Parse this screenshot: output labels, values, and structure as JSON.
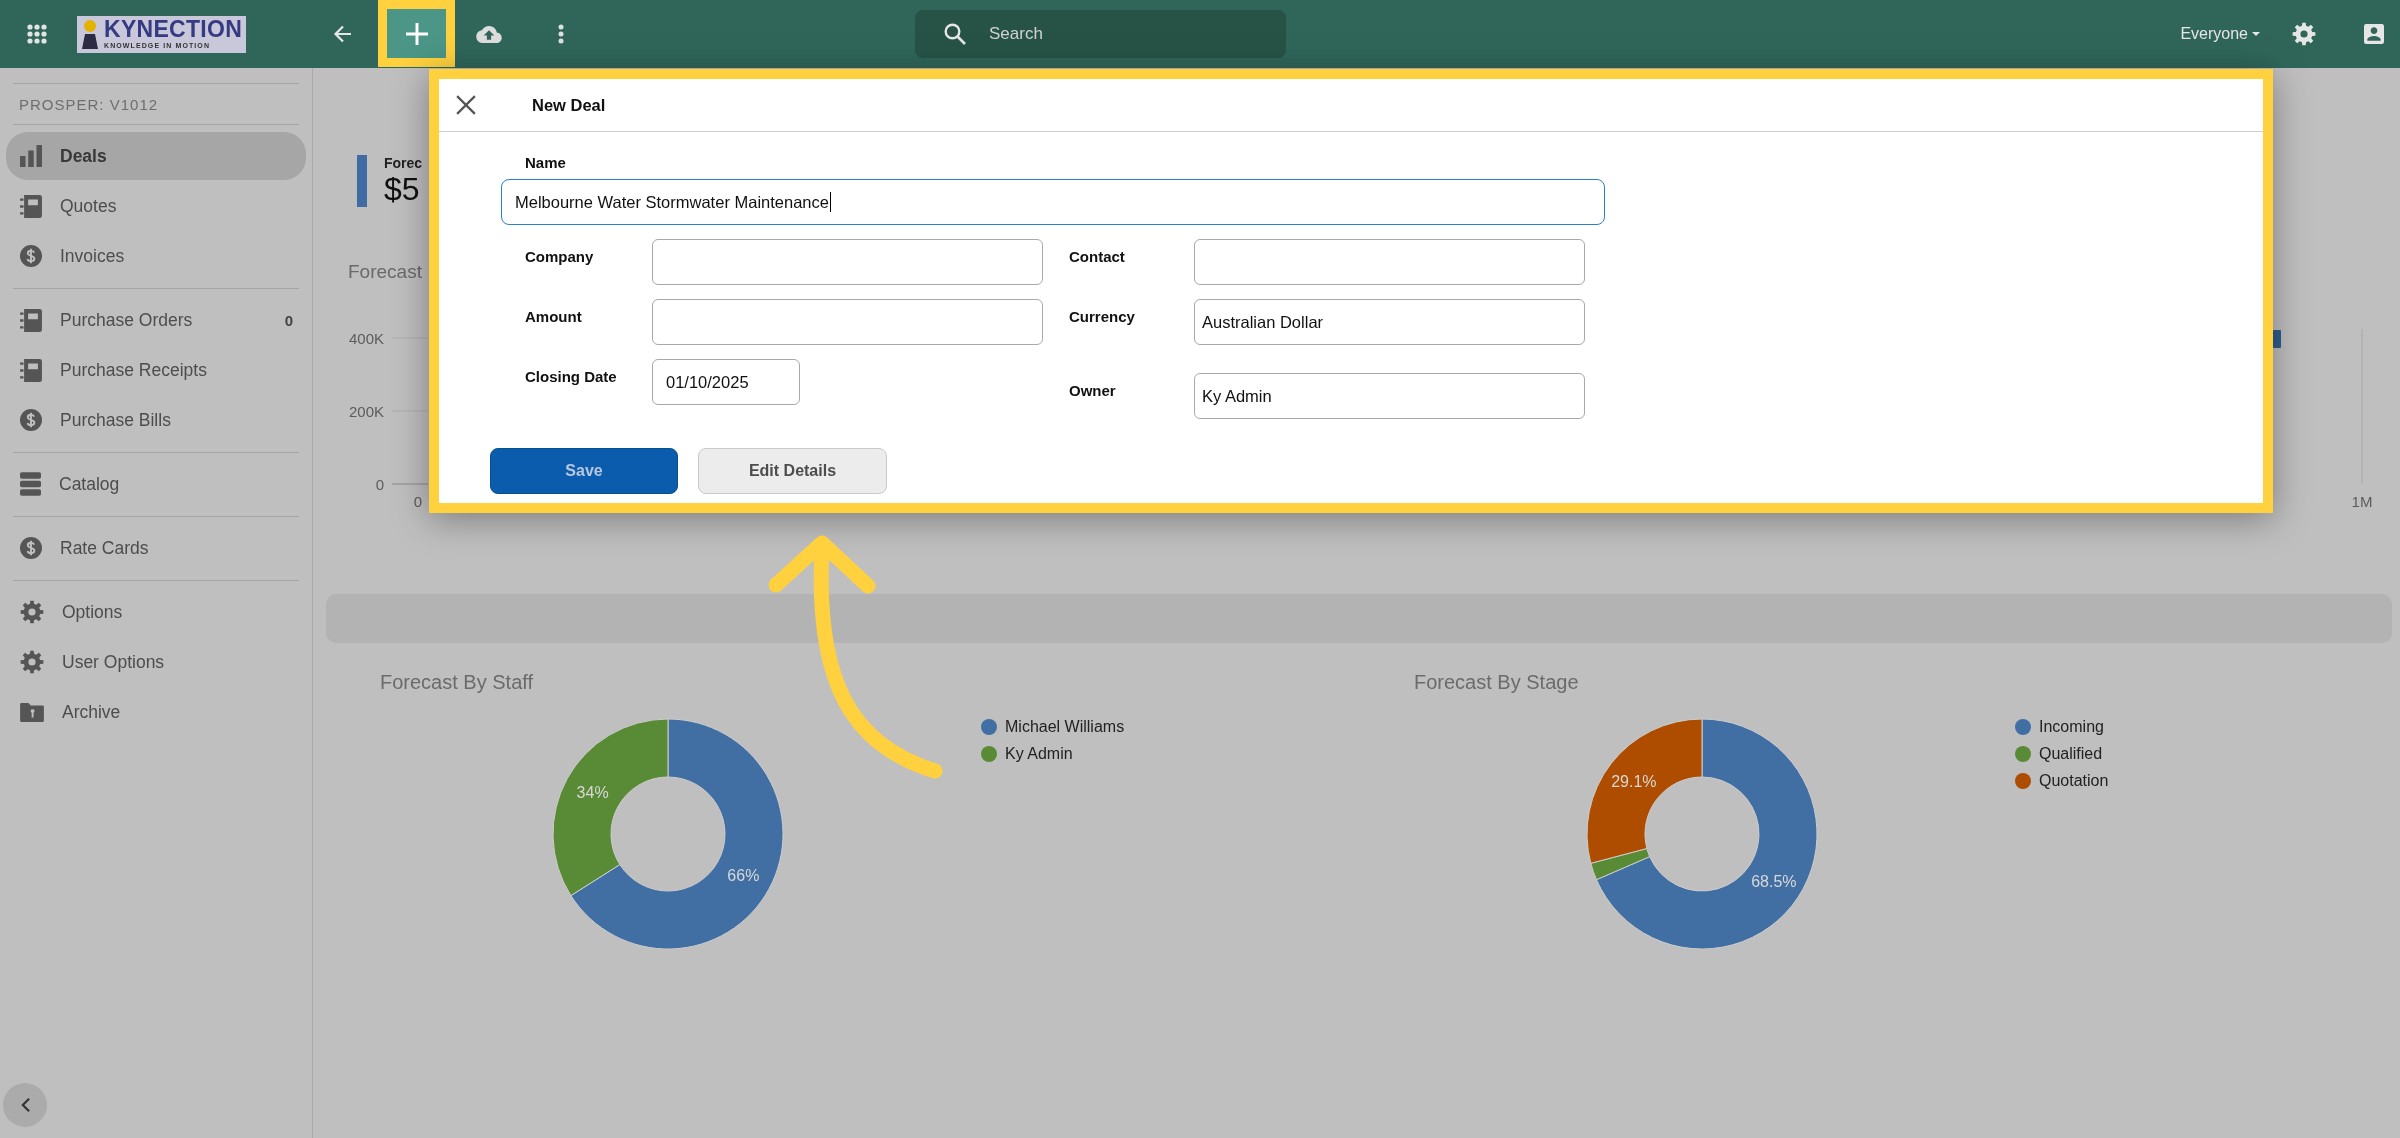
{
  "topbar": {
    "logo": {
      "name": "KYNECTION",
      "tagline": "KNOWLEDGE IN MOTION"
    },
    "search": {
      "placeholder": "Search"
    },
    "scope": "Everyone"
  },
  "sidebar": {
    "header": "PROSPER: V1012",
    "sections": [
      {
        "items": [
          {
            "label": "Deals",
            "kind": "report",
            "selected": true
          },
          {
            "label": "Quotes",
            "kind": "document",
            "selected": false
          },
          {
            "label": "Invoices",
            "kind": "payment",
            "selected": false
          }
        ]
      },
      {
        "items": [
          {
            "label": "Purchase Orders",
            "kind": "document",
            "selected": false,
            "count": "0"
          },
          {
            "label": "Purchase Receipts",
            "kind": "document",
            "selected": false
          },
          {
            "label": "Purchase Bills",
            "kind": "payment",
            "selected": false
          }
        ]
      },
      {
        "items": [
          {
            "label": "Catalog",
            "kind": "catalog",
            "selected": false
          }
        ]
      },
      {
        "items": [
          {
            "label": "Rate Cards",
            "kind": "payment",
            "selected": false
          }
        ]
      },
      {
        "items": [
          {
            "label": "Options",
            "kind": "settings",
            "selected": false
          },
          {
            "label": "User Options",
            "kind": "settings",
            "selected": false
          },
          {
            "label": "Archive",
            "kind": "archive",
            "selected": false
          }
        ]
      }
    ]
  },
  "forecast_summary": {
    "label": "Forec",
    "value": "$5"
  },
  "forecast_chart": {
    "title": "Forecast",
    "y_ticks": [
      "400K",
      "200K",
      "0"
    ],
    "x_ticks": [
      "0",
      "1M"
    ]
  },
  "panels": [
    {
      "chart_data": {
        "type": "donut",
        "title": "Forecast By Staff",
        "categories": [
          "Michael Williams",
          "Ky Admin"
        ],
        "values": [
          66,
          34
        ],
        "colors": [
          "#416fa3",
          "#598a36"
        ],
        "value_labels": [
          "66%",
          "34%"
        ],
        "legend": "right"
      }
    },
    {
      "chart_data": {
        "type": "donut",
        "title": "Forecast By Stage",
        "categories": [
          "Incoming",
          "Qualified",
          "Quotation"
        ],
        "values": [
          68.5,
          2.4,
          29.1
        ],
        "colors": [
          "#416fa3",
          "#598a36",
          "#ae4d00"
        ],
        "value_labels": [
          "68.5%",
          null,
          "29.1%"
        ],
        "legend": "right"
      }
    }
  ],
  "dialog": {
    "title": "New Deal",
    "name_field": {
      "label": "Name",
      "value": "Melbourne Water Stormwater Maintenance",
      "focused": true
    },
    "rows": [
      {
        "fields": [
          {
            "label": "Company",
            "kind": "text",
            "focused": false
          },
          {
            "label": "Contact",
            "kind": "text",
            "focused": false
          }
        ]
      },
      {
        "fields": [
          {
            "label": "Amount",
            "kind": "text",
            "focused": false
          },
          {
            "label": "Currency",
            "kind": "select",
            "value": "Australian Dollar",
            "focused": false
          }
        ]
      },
      {
        "fields": [
          {
            "label": "Closing Date",
            "kind": "date",
            "value": "01/10/2025",
            "focused": false
          },
          {
            "label": "Owner",
            "kind": "select",
            "value": "Ky Admin",
            "focused": false
          }
        ]
      }
    ],
    "buttons": [
      {
        "label": "Save",
        "kind": "primary"
      },
      {
        "label": "Edit Details",
        "kind": "secondary"
      }
    ]
  }
}
